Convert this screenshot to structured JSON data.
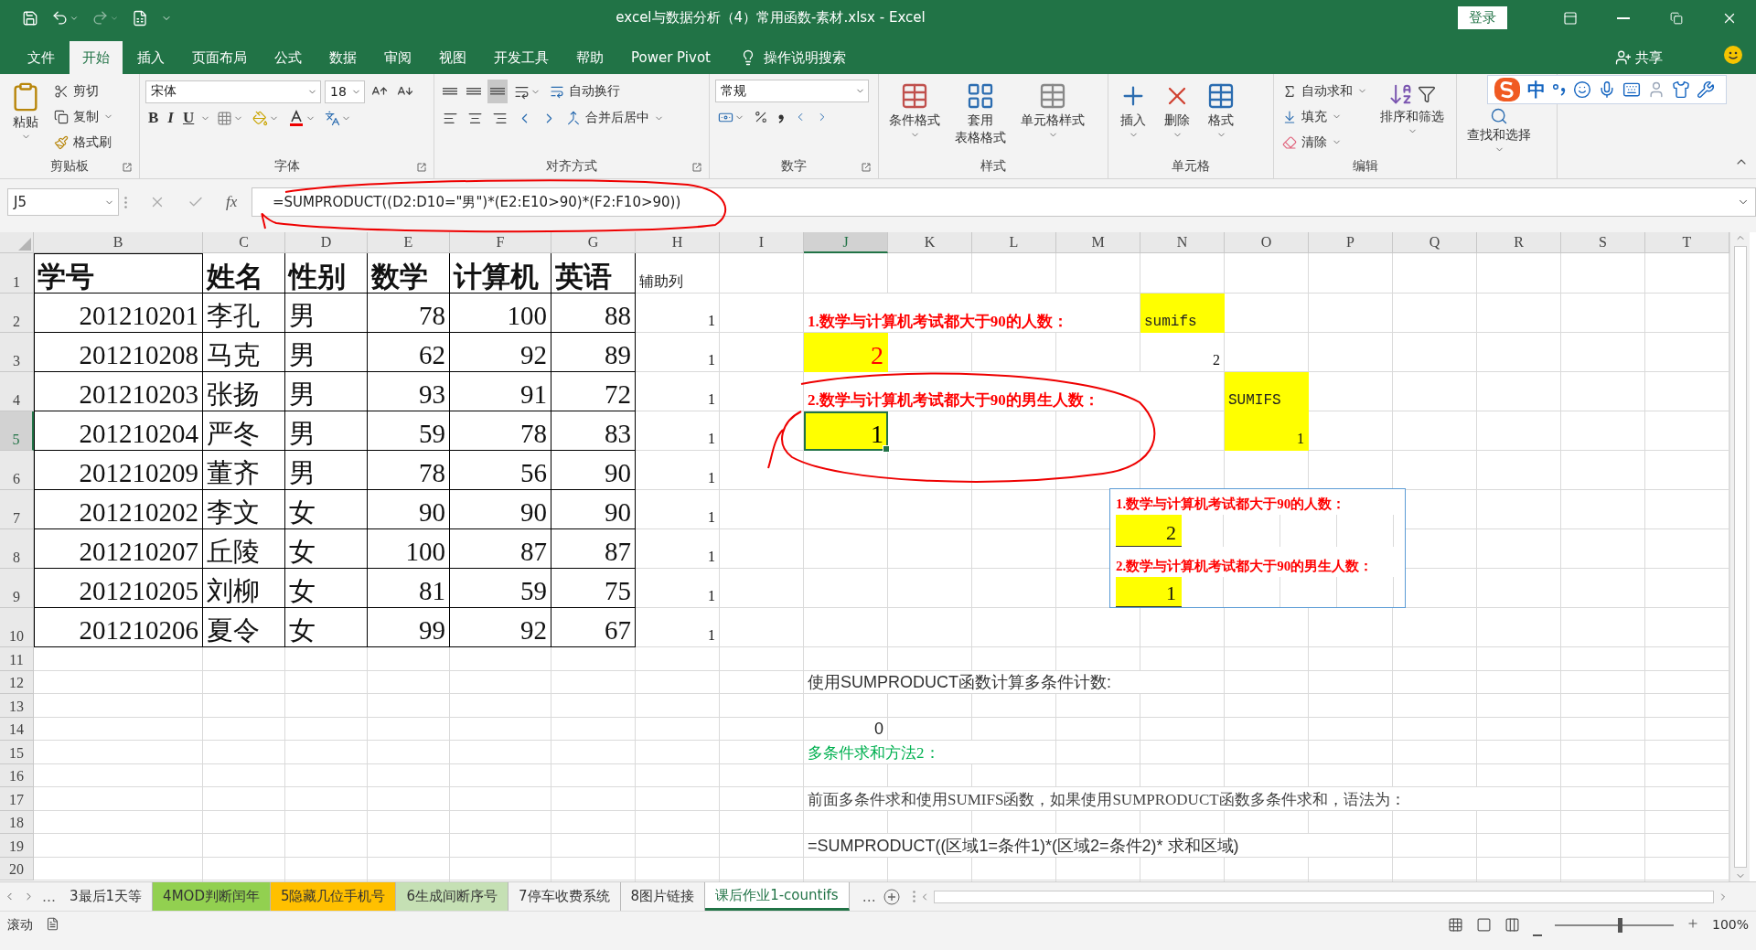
{
  "window": {
    "title": "excel与数据分析（4）常用函数-素材.xlsx - Excel",
    "login_button": "登录"
  },
  "menu_tabs": [
    {
      "label": "文件",
      "selected": false
    },
    {
      "label": "开始",
      "selected": true
    },
    {
      "label": "插入",
      "selected": false
    },
    {
      "label": "页面布局",
      "selected": false
    },
    {
      "label": "公式",
      "selected": false
    },
    {
      "label": "数据",
      "selected": false
    },
    {
      "label": "审阅",
      "selected": false
    },
    {
      "label": "视图",
      "selected": false
    },
    {
      "label": "开发工具",
      "selected": false
    },
    {
      "label": "帮助",
      "selected": false
    },
    {
      "label": "Power Pivot",
      "selected": false
    }
  ],
  "tell_me": "操作说明搜索",
  "share": "共享",
  "ribbon": {
    "clipboard": {
      "title": "剪贴板",
      "paste": "粘贴",
      "cut": "剪切",
      "copy": "复制",
      "format_painter": "格式刷"
    },
    "font": {
      "title": "字体",
      "font_name": "宋体",
      "font_size": "18",
      "bold": "B",
      "italic": "I",
      "underline": "U"
    },
    "alignment": {
      "title": "对齐方式",
      "wrap": "自动换行",
      "merge": "合并后居中"
    },
    "number": {
      "title": "数字",
      "format": "常规"
    },
    "styles": {
      "title": "样式",
      "conditional": "条件格式",
      "table_format": [
        "套用",
        "表格格式"
      ],
      "cell_styles": "单元格样式"
    },
    "cells": {
      "title": "单元格",
      "insert": "插入",
      "delete": "删除",
      "format": "格式"
    },
    "editing": {
      "title": "编辑",
      "autosum": "自动求和",
      "fill": "填充",
      "clear": "清除",
      "sort": "排序和筛选",
      "find": "查找和选择"
    }
  },
  "ime_toolbar": {
    "mode": "中"
  },
  "formula_bar": {
    "name_box": "J5",
    "fx": "fx",
    "formula": "=SUMPRODUCT((D2:D10=\"男\")*(E2:E10>90)*(F2:F10>90))"
  },
  "sheet": {
    "columns": [
      {
        "label": "B",
        "selected": false
      },
      {
        "label": "C",
        "selected": false
      },
      {
        "label": "D",
        "selected": false
      },
      {
        "label": "E",
        "selected": false
      },
      {
        "label": "F",
        "selected": false
      },
      {
        "label": "G",
        "selected": false
      },
      {
        "label": "H",
        "selected": false
      },
      {
        "label": "I",
        "selected": false
      },
      {
        "label": "J",
        "selected": true
      },
      {
        "label": "K",
        "selected": false
      },
      {
        "label": "L",
        "selected": false
      },
      {
        "label": "M",
        "selected": false
      },
      {
        "label": "N",
        "selected": false
      },
      {
        "label": "O",
        "selected": false
      },
      {
        "label": "P",
        "selected": false
      },
      {
        "label": "Q",
        "selected": false
      },
      {
        "label": "R",
        "selected": false
      },
      {
        "label": "S",
        "selected": false
      },
      {
        "label": "T",
        "selected": false
      }
    ],
    "table": {
      "columns": [
        {
          "label": "学号",
          "kind": "number"
        },
        {
          "label": "姓名",
          "kind": "text"
        },
        {
          "label": "性别",
          "kind": "text"
        },
        {
          "label": "数学",
          "kind": "number"
        },
        {
          "label": "计算机",
          "kind": "number"
        },
        {
          "label": "英语",
          "kind": "number"
        }
      ],
      "rows": [
        [
          "201210201",
          "李孔",
          "男",
          "78",
          "100",
          "88"
        ],
        [
          "201210208",
          "马克",
          "男",
          "62",
          "92",
          "89"
        ],
        [
          "201210203",
          "张扬",
          "男",
          "93",
          "91",
          "72"
        ],
        [
          "201210204",
          "严冬",
          "男",
          "59",
          "78",
          "83"
        ],
        [
          "201210209",
          "董齐",
          "男",
          "78",
          "56",
          "90"
        ],
        [
          "201210202",
          "李文",
          "女",
          "90",
          "90",
          "90"
        ],
        [
          "201210207",
          "丘陵",
          "女",
          "100",
          "87",
          "87"
        ],
        [
          "201210205",
          "刘柳",
          "女",
          "81",
          "59",
          "75"
        ],
        [
          "201210206",
          "夏令",
          "女",
          "99",
          "92",
          "67"
        ]
      ]
    },
    "rows": [
      {
        "label": "1",
        "selected": false,
        "cells": [
          {
            "kind": "note",
            "text": "辅助列",
            "highlighted": false
          }
        ]
      },
      {
        "label": "2",
        "selected": false,
        "cells": [
          {
            "kind": "count",
            "text": "1",
            "highlighted": false
          },
          null,
          {
            "kind": "label",
            "text": "1.数学与计算机考试都大于90的人数：",
            "highlighted": false
          },
          null,
          null,
          null,
          {
            "kind": "note",
            "text": "sumifs",
            "highlighted": true
          }
        ]
      },
      {
        "label": "3",
        "selected": false,
        "cells": [
          {
            "kind": "count",
            "text": "1",
            "highlighted": false
          },
          null,
          {
            "kind": "value",
            "text": "2",
            "highlighted": true,
            "color": "#ff0000"
          },
          null,
          null,
          null,
          {
            "kind": "count",
            "text": "2",
            "highlighted": false
          }
        ]
      },
      {
        "label": "4",
        "selected": false,
        "cells": [
          {
            "kind": "count",
            "text": "1",
            "highlighted": false
          },
          null,
          {
            "kind": "label",
            "text": "2.数学与计算机考试都大于90的男生人数：",
            "highlighted": false
          },
          null,
          null,
          null,
          null,
          {
            "kind": "note",
            "text": "SUMIFS",
            "highlighted": true
          }
        ]
      },
      {
        "label": "5",
        "selected": true,
        "cells": [
          {
            "kind": "count",
            "text": "1",
            "highlighted": false
          },
          null,
          {
            "kind": "value",
            "text": "1",
            "highlighted": true,
            "color": "#000000"
          },
          null,
          null,
          null,
          null,
          {
            "kind": "count",
            "text": "1",
            "highlighted": true
          }
        ]
      },
      {
        "label": "6",
        "selected": false,
        "cells": [
          {
            "kind": "count",
            "text": "1",
            "highlighted": false
          }
        ]
      },
      {
        "label": "7",
        "selected": false,
        "cells": [
          {
            "kind": "count",
            "text": "1",
            "highlighted": false
          }
        ]
      },
      {
        "label": "8",
        "selected": false,
        "cells": [
          {
            "kind": "count",
            "text": "1",
            "highlighted": false
          }
        ]
      },
      {
        "label": "9",
        "selected": false,
        "cells": [
          {
            "kind": "count",
            "text": "1",
            "highlighted": false
          }
        ]
      },
      {
        "label": "10",
        "selected": false,
        "cells": [
          {
            "kind": "count",
            "text": "1",
            "highlighted": false
          }
        ]
      },
      {
        "label": "11",
        "selected": false
      },
      {
        "label": "12",
        "selected": false,
        "cells": [
          null,
          null,
          {
            "kind": "caption",
            "text": "使用SUMPRODUCT函数计算多条件计数:",
            "highlighted": false
          }
        ]
      },
      {
        "label": "13",
        "selected": false
      },
      {
        "label": "14",
        "selected": false,
        "cells": [
          null,
          null,
          {
            "kind": "number",
            "text": "0",
            "highlighted": false
          }
        ]
      },
      {
        "label": "15",
        "selected": false,
        "cells": [
          null,
          null,
          {
            "kind": "heading",
            "text": "多条件求和方法2：",
            "highlighted": false
          }
        ]
      },
      {
        "label": "16",
        "selected": false
      },
      {
        "label": "17",
        "selected": false,
        "cells": [
          null,
          null,
          {
            "kind": "sentence",
            "text": "前面多条件求和使用SUMIFS函数，如果使用SUMPRODUCT函数多条件求和，语法为：",
            "highlighted": false
          }
        ]
      },
      {
        "label": "18",
        "selected": false
      },
      {
        "label": "19",
        "selected": false,
        "cells": [
          null,
          null,
          {
            "kind": "caption",
            "text": "=SUMPRODUCT((区域1=条件1)*(区域2=条件2)* 求和区域)",
            "highlighted": false
          }
        ]
      },
      {
        "label": "20",
        "selected": false
      }
    ]
  },
  "snapshot": {
    "lines": [
      {
        "kind": "label",
        "text": "1.数学与计算机考试都大于90的人数："
      },
      {
        "kind": "value",
        "text": "2"
      },
      {
        "kind": "label",
        "text": "2.数学与计算机考试都大于90的男生人数："
      },
      {
        "kind": "value",
        "text": "1"
      }
    ]
  },
  "sheet_tabs": {
    "more_left": "…",
    "tabs": [
      {
        "label": "3最后1天等",
        "selected": false
      },
      {
        "label": "4MOD判断闰年",
        "selected": false,
        "color": "#92d050"
      },
      {
        "label": "5隐藏几位手机号",
        "selected": false,
        "color": "#ffc000"
      },
      {
        "label": "6生成间断序号",
        "selected": false,
        "color": "#c5e0b4"
      },
      {
        "label": "7停车收费系统",
        "selected": false
      },
      {
        "label": "8图片链接",
        "selected": false
      },
      {
        "label": "课后作业1-countifs",
        "selected": true
      }
    ],
    "more_right": "…"
  },
  "status_bar": {
    "mode": "滚动",
    "zoom": "100%",
    "zoom_slider": {
      "level": 0.55
    }
  }
}
